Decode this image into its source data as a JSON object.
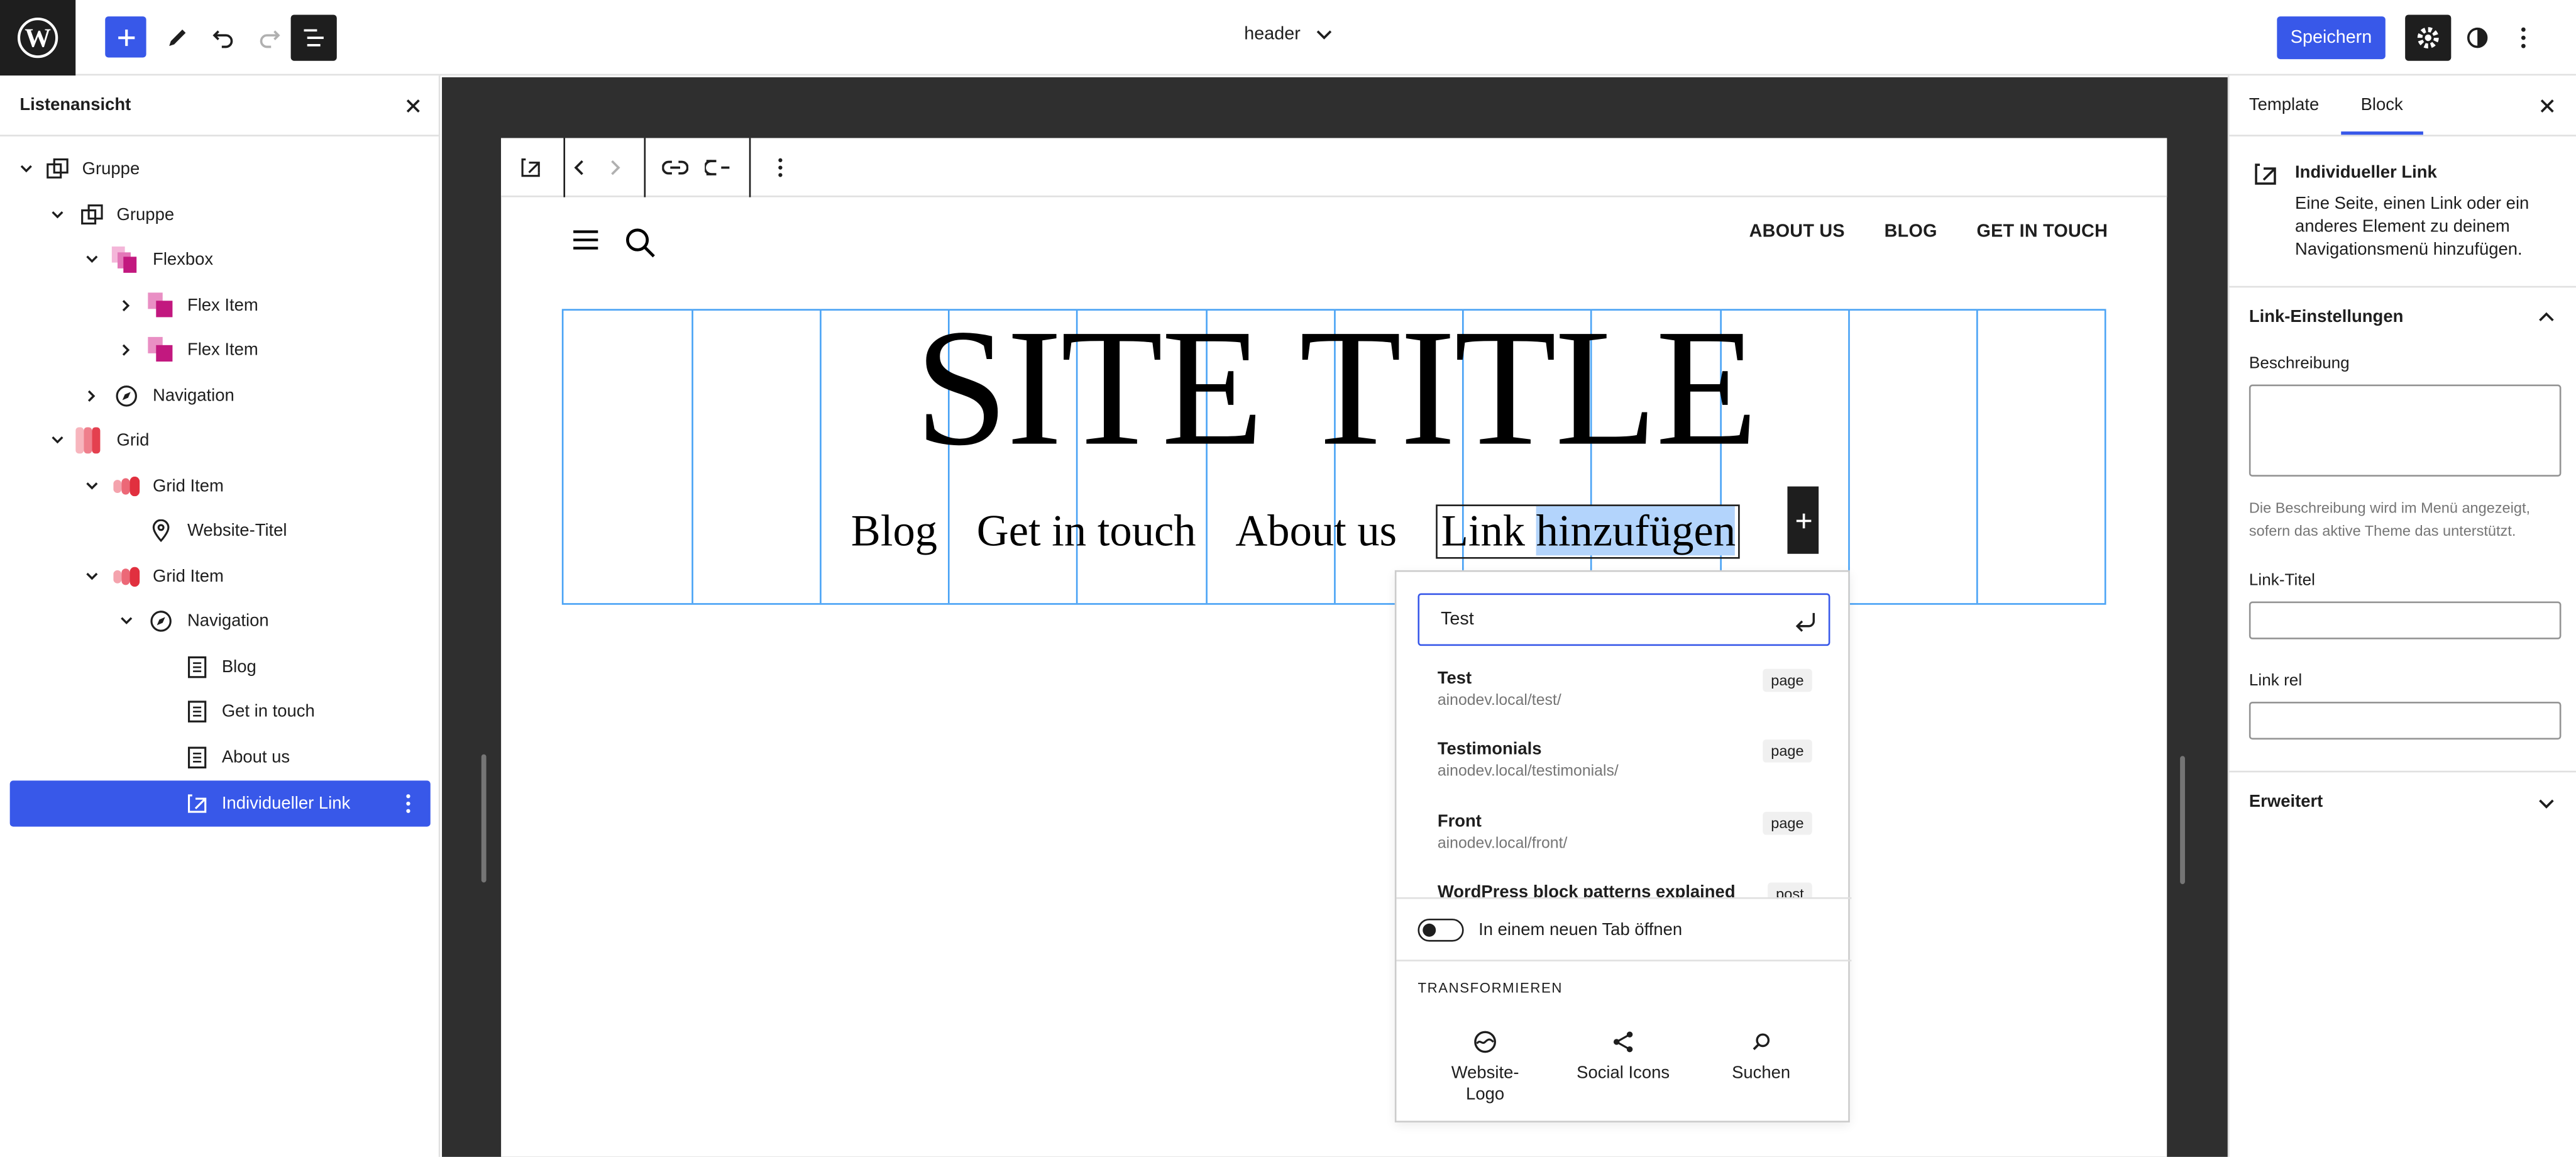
{
  "topbar": {
    "document_title": "header",
    "save_label": "Speichern"
  },
  "list_view": {
    "title": "Listenansicht",
    "items": [
      {
        "label": "Gruppe"
      },
      {
        "label": "Gruppe"
      },
      {
        "label": "Flexbox"
      },
      {
        "label": "Flex Item"
      },
      {
        "label": "Flex Item"
      },
      {
        "label": "Navigation"
      },
      {
        "label": "Grid"
      },
      {
        "label": "Grid Item"
      },
      {
        "label": "Website-Titel"
      },
      {
        "label": "Grid Item"
      },
      {
        "label": "Navigation"
      },
      {
        "label": "Blog"
      },
      {
        "label": "Get in touch"
      },
      {
        "label": "About us"
      },
      {
        "label": "Individueller Link"
      }
    ]
  },
  "canvas": {
    "top_nav": [
      "ABOUT US",
      "BLOG",
      "GET IN TOUCH"
    ],
    "site_title": "SITE TITLE",
    "nav_links": [
      "Blog",
      "Get in touch",
      "About us"
    ],
    "link_add_prefix": "Link ",
    "link_add_selected": "hinzufügen"
  },
  "link_popover": {
    "search_value": "Test",
    "suggestions": [
      {
        "title": "Test",
        "url": "ainodev.local/test/",
        "type": "page"
      },
      {
        "title": "Testimonials",
        "url": "ainodev.local/testimonials/",
        "type": "page"
      },
      {
        "title": "Front",
        "url": "ainodev.local/front/",
        "type": "page"
      },
      {
        "title": "WordPress block patterns explained",
        "url": "",
        "type": "post"
      }
    ],
    "new_tab_label": "In einem neuen Tab öffnen",
    "new_tab_enabled": false,
    "transform_heading": "Transformieren",
    "transforms": [
      {
        "label": "Website-Logo",
        "icon": "site-logo-icon"
      },
      {
        "label": "Social Icons",
        "icon": "share-icon"
      },
      {
        "label": "Suchen",
        "icon": "search-icon"
      }
    ]
  },
  "sidebar": {
    "tabs": [
      "Template",
      "Block"
    ],
    "active_tab": "Block",
    "block_title": "Individueller Link",
    "block_description": "Eine Seite, einen Link oder ein anderes Element zu deinem Navigationsmenü hinzufügen.",
    "link_settings_heading": "Link-Einstellungen",
    "description_label": "Beschreibung",
    "description_help": "Die Beschreibung wird im Menü angezeigt, sofern das aktive Theme das unterstützt.",
    "link_title_label": "Link-Titel",
    "link_rel_label": "Link rel",
    "advanced_heading": "Erweitert"
  },
  "colors": {
    "accent": "#3858e9",
    "dark": "#1e1e1e",
    "canvas_bg": "#2f2f2f",
    "grid_outline": "#4aa3f5",
    "selection": "#b3d4fc"
  }
}
